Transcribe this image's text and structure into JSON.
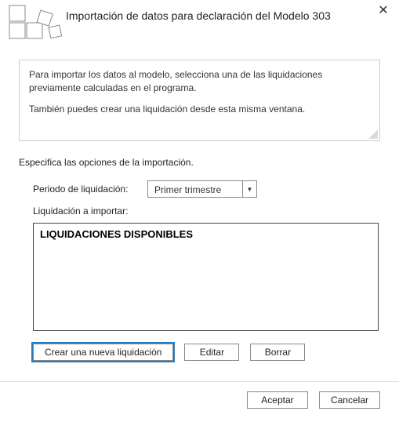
{
  "dialog": {
    "title": "Importación de datos para declaración del Modelo 303",
    "close_symbol": "✕"
  },
  "info": {
    "p1": "Para importar los datos al modelo, selecciona una de las liquidaciones previamente calculadas en el programa.",
    "p2": "También puedes crear una liquidación desde esta misma ventana."
  },
  "section_label": "Especifica las opciones de la importación.",
  "form": {
    "periodo_label": "Periodo de liquidación:",
    "periodo_value": "Primer trimestre",
    "liquidacion_label": "Liquidación a importar:"
  },
  "listbox": {
    "header": "LIQUIDACIONES DISPONIBLES"
  },
  "actions": {
    "create_label": "Crear una nueva liquidación",
    "edit_label": "Editar",
    "delete_label": "Borrar"
  },
  "footer": {
    "accept_label": "Aceptar",
    "cancel_label": "Cancelar"
  }
}
